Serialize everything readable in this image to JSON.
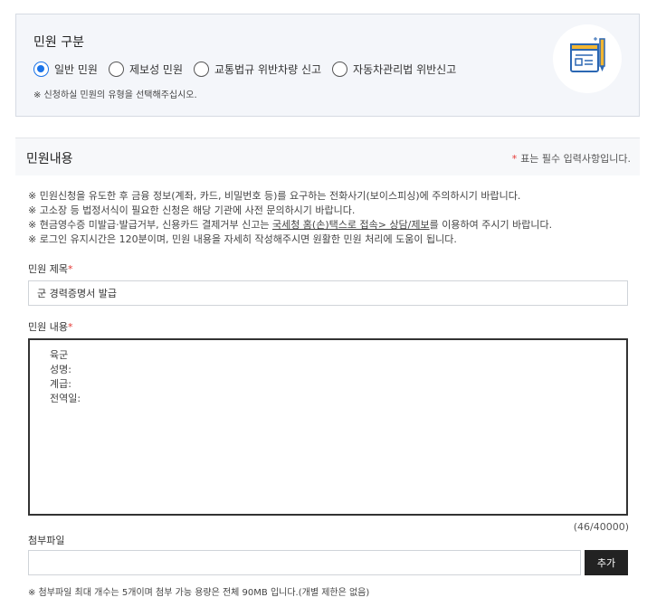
{
  "complaint_type": {
    "title": "민원 구분",
    "options": [
      {
        "label": "일반 민원",
        "checked": true
      },
      {
        "label": "제보성 민원",
        "checked": false
      },
      {
        "label": "교통법규 위반차량 신고",
        "checked": false
      },
      {
        "label": "자동차관리법 위반신고",
        "checked": false
      }
    ],
    "note": "※ 신청하실 민원의 유형을 선택해주십시오."
  },
  "content_section": {
    "title": "민원내용",
    "required_star": "*",
    "required_note": "표는 필수 입력사항입니다."
  },
  "notices": {
    "line1": "※ 민원신청을 유도한 후 금융 정보(계좌, 카드, 비밀번호 등)를 요구하는 전화사기(보이스피싱)에 주의하시기 바랍니다.",
    "line2": "※ 고소장 등 법정서식이 필요한 신청은 해당 기관에 사전 문의하시기 바랍니다.",
    "line3_prefix": "※ 현금영수증 미발급·발급거부, 신용카드 결제거부 신고는 ",
    "line3_link": "국세청 홈(손)택스로 접속> 상담/제보",
    "line3_suffix": "를 이용하여 주시기 바랍니다.",
    "line4": "※ 로그인 유지시간은 120분이며, 민원 내용을 자세히 작성해주시면 원활한 민원 처리에 도움이 됩니다."
  },
  "title_field": {
    "label": "민원 제목",
    "star": "*",
    "value": "군 경력증명서 발급"
  },
  "content_field": {
    "label": "민원 내용",
    "star": "*",
    "value": "육군\n성명:\n계급:\n전역일:",
    "counter": "(46/40000)"
  },
  "attachment": {
    "label": "첨부파일",
    "add_label": "추가",
    "note": "※ 첨부파일 최대 개수는 5개이며 첨부 가능 용량은 전체 90MB 입니다.(개별 제한은 없음)"
  },
  "colors": {
    "accent": "#1a73e8",
    "required": "#e53935",
    "illustration_primary": "#2b67b3",
    "illustration_secondary": "#f2b632"
  },
  "icons": {
    "illustration": "document-pencil-icon"
  }
}
